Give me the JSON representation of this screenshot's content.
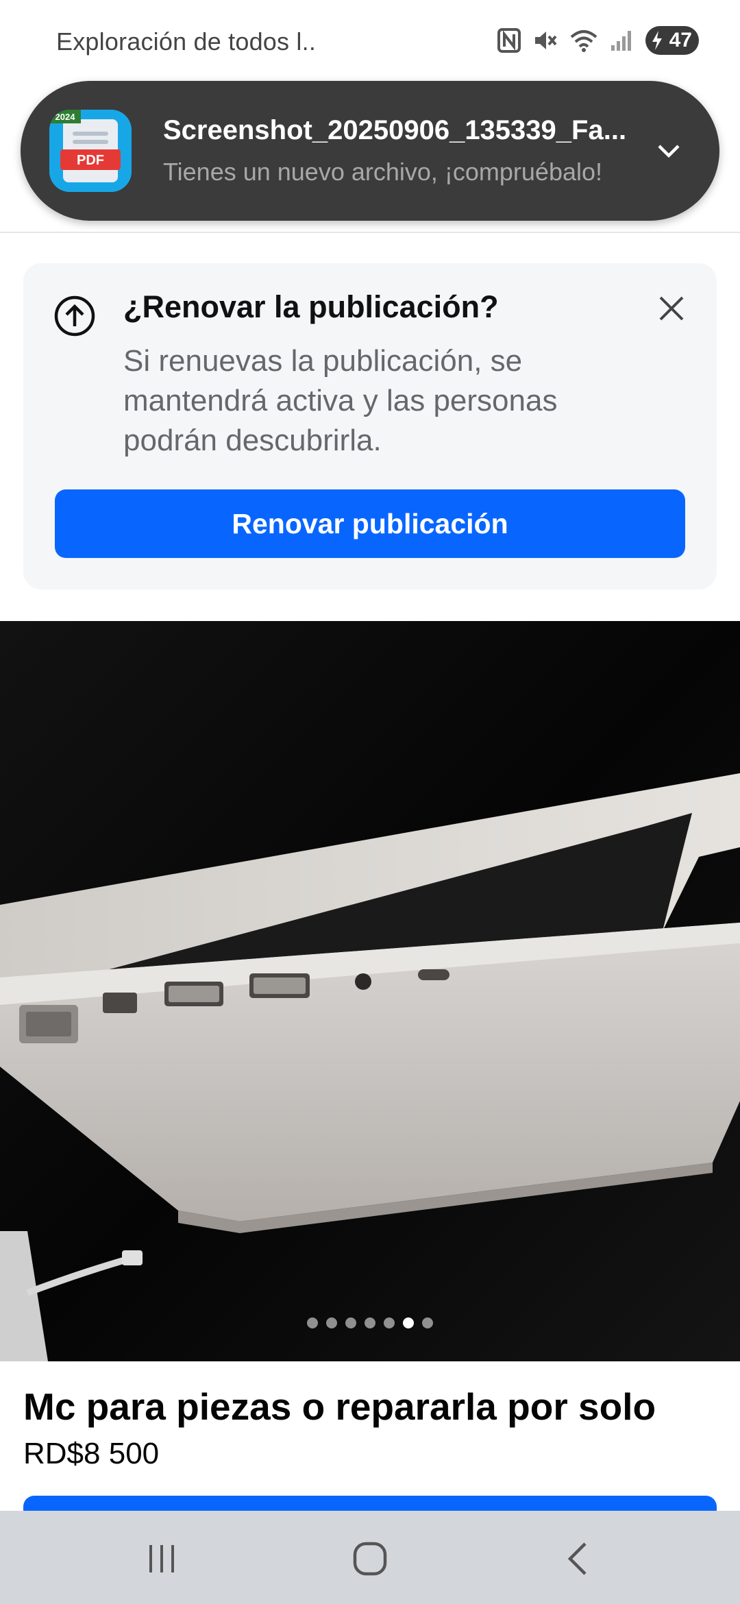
{
  "status_bar": {
    "app_text": "Exploración de todos l..",
    "battery_level": "47"
  },
  "notification": {
    "app_icon_badge": "2024",
    "app_icon_label": "PDF",
    "title": "Screenshot_20250906_135339_Fa...",
    "body": "Tienes un nuevo archivo, ¡compruébalo!"
  },
  "renew_card": {
    "title": "¿Renovar la publicación?",
    "body": "Si renuevas la publicación, se mantendrá activa y las personas podrán descubrirla.",
    "button_label": "Renovar publicación"
  },
  "listing": {
    "photo_count": 7,
    "active_photo_index": 5,
    "title": "Mc para piezas o repararla por solo",
    "price": "RD$8 500"
  },
  "icons": {
    "status": [
      "nfc-icon",
      "mute-icon",
      "wifi-icon",
      "signal-icon",
      "battery-icon"
    ],
    "notification": [
      "pdf-app-icon",
      "chevron-down-icon"
    ],
    "renew_card": [
      "arrow-up-circle-icon",
      "close-icon"
    ],
    "nav": [
      "recent-apps-icon",
      "home-icon",
      "back-icon"
    ]
  },
  "colors": {
    "primary_button": "#0866ff",
    "notification_bg": "#3b3b3b",
    "card_bg": "#f5f6f8",
    "nav_bar_bg": "#d3d6db"
  }
}
